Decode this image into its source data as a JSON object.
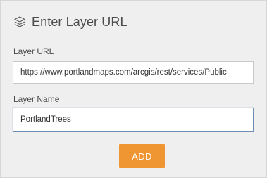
{
  "header": {
    "icon": "layers-icon",
    "title": "Enter Layer URL"
  },
  "layer_url": {
    "label": "Layer URL",
    "value": "https://www.portlandmaps.com/arcgis/rest/services/Public"
  },
  "layer_name": {
    "label": "Layer Name",
    "value": "PortlandTrees"
  },
  "actions": {
    "add_label": "ADD"
  },
  "colors": {
    "panel_bg": "#efefef",
    "button_bg": "#ef9633",
    "focus_border": "#6e8db3"
  }
}
